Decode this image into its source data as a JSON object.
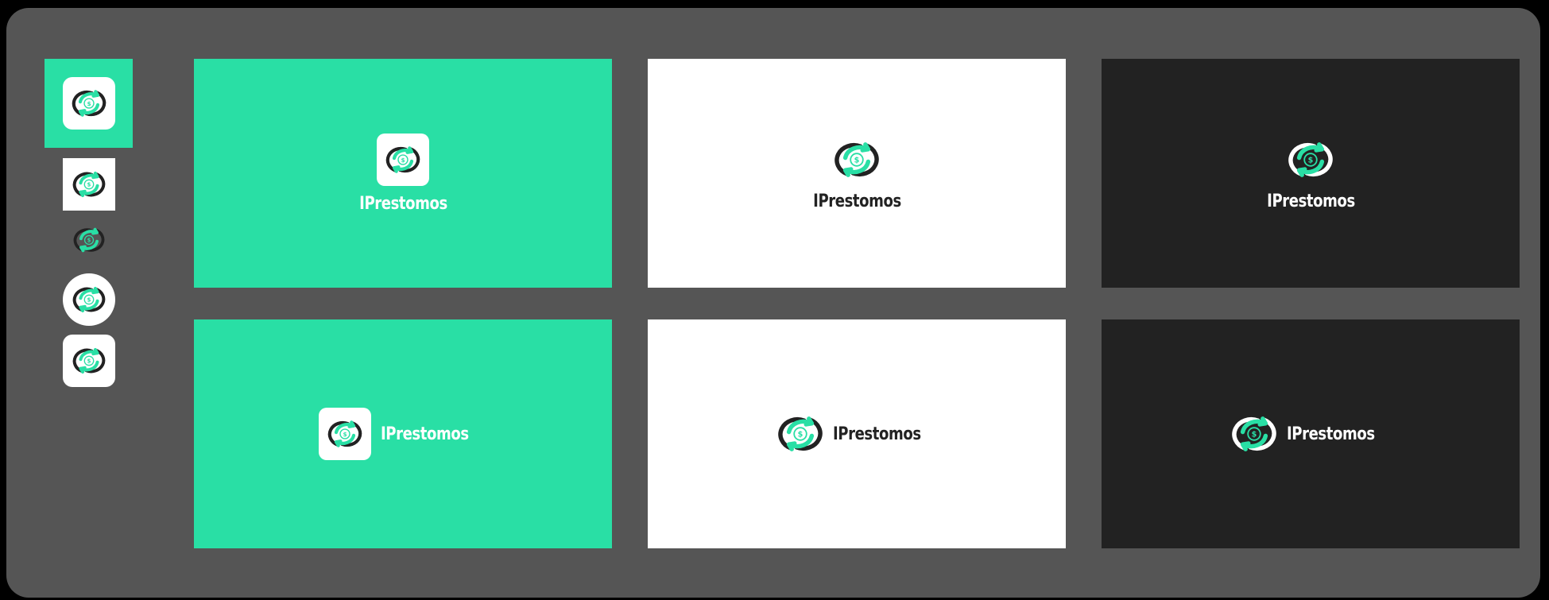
{
  "brand": {
    "name": "IPrestomos",
    "colors": {
      "accent": "#29dfa5",
      "dark": "#222222",
      "light": "#ffffff",
      "canvas": "#555555"
    }
  },
  "icons": {
    "logo": "circular-arrows-dollar-icon"
  },
  "variants": {
    "thumbnails": [
      {
        "style": "white-rounded-on-green"
      },
      {
        "style": "white-square"
      },
      {
        "style": "transparent-dark"
      },
      {
        "style": "white-circle"
      },
      {
        "style": "white-rounded"
      }
    ],
    "panels": [
      {
        "bg": "green",
        "layout": "stacked",
        "word": "IPrestomos"
      },
      {
        "bg": "white",
        "layout": "stacked",
        "word": "IPrestomos"
      },
      {
        "bg": "dark",
        "layout": "stacked",
        "word": "IPrestomos"
      },
      {
        "bg": "green",
        "layout": "horizontal",
        "word": "IPrestomos"
      },
      {
        "bg": "white",
        "layout": "horizontal",
        "word": "IPrestomos"
      },
      {
        "bg": "dark",
        "layout": "horizontal",
        "word": "IPrestomos"
      }
    ]
  }
}
